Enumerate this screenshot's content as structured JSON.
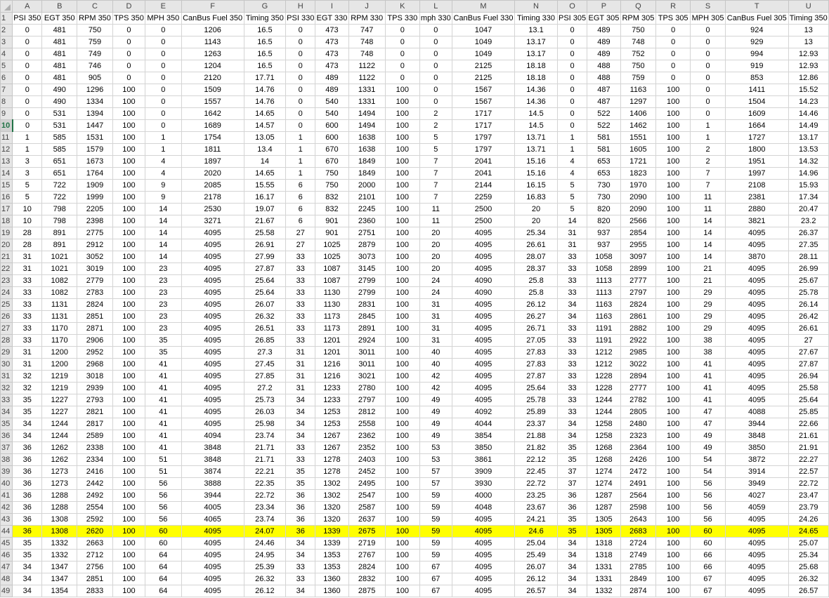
{
  "columns": [
    "A",
    "B",
    "C",
    "D",
    "E",
    "F",
    "G",
    "H",
    "I",
    "J",
    "K",
    "L",
    "M",
    "N",
    "O",
    "P",
    "Q",
    "R",
    "S",
    "T",
    "U"
  ],
  "highlight_color": "#ffff00",
  "selected_row": 10,
  "highlighted_row": 44,
  "rows": [
    {
      "num": 1,
      "cells": [
        "PSI 350",
        "EGT 350",
        "RPM 350",
        "TPS 350",
        "MPH 350",
        "CanBus Fuel 350",
        "Timing 350",
        "PSI 330",
        "EGT 330",
        "RPM 330",
        "TPS 330",
        "mph 330",
        "CanBus Fuel 330",
        "Timing 330",
        "PSI 305",
        "EGT 305",
        "RPM 305",
        "TPS 305",
        "MPH 305",
        "CanBus Fuel 305",
        "Timing 350"
      ]
    },
    {
      "num": 2,
      "cells": [
        "0",
        "481",
        "750",
        "0",
        "0",
        "1206",
        "16.5",
        "0",
        "473",
        "747",
        "0",
        "0",
        "1047",
        "13.1",
        "0",
        "489",
        "750",
        "0",
        "0",
        "924",
        "13"
      ]
    },
    {
      "num": 3,
      "cells": [
        "0",
        "481",
        "759",
        "0",
        "0",
        "1143",
        "16.5",
        "0",
        "473",
        "748",
        "0",
        "0",
        "1049",
        "13.17",
        "0",
        "489",
        "748",
        "0",
        "0",
        "929",
        "13"
      ]
    },
    {
      "num": 4,
      "cells": [
        "0",
        "481",
        "749",
        "0",
        "0",
        "1263",
        "16.5",
        "0",
        "473",
        "748",
        "0",
        "0",
        "1049",
        "13.17",
        "0",
        "489",
        "752",
        "0",
        "0",
        "994",
        "12.93"
      ]
    },
    {
      "num": 5,
      "cells": [
        "0",
        "481",
        "746",
        "0",
        "0",
        "1204",
        "16.5",
        "0",
        "473",
        "1122",
        "0",
        "0",
        "2125",
        "18.18",
        "0",
        "488",
        "750",
        "0",
        "0",
        "919",
        "12.93"
      ]
    },
    {
      "num": 6,
      "cells": [
        "0",
        "481",
        "905",
        "0",
        "0",
        "2120",
        "17.71",
        "0",
        "489",
        "1122",
        "0",
        "0",
        "2125",
        "18.18",
        "0",
        "488",
        "759",
        "0",
        "0",
        "853",
        "12.86"
      ]
    },
    {
      "num": 7,
      "cells": [
        "0",
        "490",
        "1296",
        "100",
        "0",
        "1509",
        "14.76",
        "0",
        "489",
        "1331",
        "100",
        "0",
        "1567",
        "14.36",
        "0",
        "487",
        "1163",
        "100",
        "0",
        "1411",
        "15.52"
      ]
    },
    {
      "num": 8,
      "cells": [
        "0",
        "490",
        "1334",
        "100",
        "0",
        "1557",
        "14.76",
        "0",
        "540",
        "1331",
        "100",
        "0",
        "1567",
        "14.36",
        "0",
        "487",
        "1297",
        "100",
        "0",
        "1504",
        "14.23"
      ]
    },
    {
      "num": 9,
      "cells": [
        "0",
        "531",
        "1394",
        "100",
        "0",
        "1642",
        "14.65",
        "0",
        "540",
        "1494",
        "100",
        "2",
        "1717",
        "14.5",
        "0",
        "522",
        "1406",
        "100",
        "0",
        "1609",
        "14.46"
      ]
    },
    {
      "num": 10,
      "cells": [
        "0",
        "531",
        "1447",
        "100",
        "0",
        "1689",
        "14.57",
        "0",
        "600",
        "1494",
        "100",
        "2",
        "1717",
        "14.5",
        "0",
        "522",
        "1462",
        "100",
        "1",
        "1664",
        "14.49"
      ]
    },
    {
      "num": 11,
      "cells": [
        "1",
        "585",
        "1531",
        "100",
        "1",
        "1754",
        "13.05",
        "1",
        "600",
        "1638",
        "100",
        "5",
        "1797",
        "13.71",
        "1",
        "581",
        "1551",
        "100",
        "1",
        "1727",
        "13.17"
      ]
    },
    {
      "num": 12,
      "cells": [
        "1",
        "585",
        "1579",
        "100",
        "1",
        "1811",
        "13.4",
        "1",
        "670",
        "1638",
        "100",
        "5",
        "1797",
        "13.71",
        "1",
        "581",
        "1605",
        "100",
        "2",
        "1800",
        "13.53"
      ]
    },
    {
      "num": 13,
      "cells": [
        "3",
        "651",
        "1673",
        "100",
        "4",
        "1897",
        "14",
        "1",
        "670",
        "1849",
        "100",
        "7",
        "2041",
        "15.16",
        "4",
        "653",
        "1721",
        "100",
        "2",
        "1951",
        "14.32"
      ]
    },
    {
      "num": 14,
      "cells": [
        "3",
        "651",
        "1764",
        "100",
        "4",
        "2020",
        "14.65",
        "1",
        "750",
        "1849",
        "100",
        "7",
        "2041",
        "15.16",
        "4",
        "653",
        "1823",
        "100",
        "7",
        "1997",
        "14.96"
      ]
    },
    {
      "num": 15,
      "cells": [
        "5",
        "722",
        "1909",
        "100",
        "9",
        "2085",
        "15.55",
        "6",
        "750",
        "2000",
        "100",
        "7",
        "2144",
        "16.15",
        "5",
        "730",
        "1970",
        "100",
        "7",
        "2108",
        "15.93"
      ]
    },
    {
      "num": 16,
      "cells": [
        "5",
        "722",
        "1999",
        "100",
        "9",
        "2178",
        "16.17",
        "6",
        "832",
        "2101",
        "100",
        "7",
        "2259",
        "16.83",
        "5",
        "730",
        "2090",
        "100",
        "11",
        "2381",
        "17.34"
      ]
    },
    {
      "num": 17,
      "cells": [
        "10",
        "798",
        "2205",
        "100",
        "14",
        "2530",
        "19.07",
        "6",
        "832",
        "2245",
        "100",
        "11",
        "2500",
        "20",
        "5",
        "820",
        "2090",
        "100",
        "11",
        "2880",
        "20.47"
      ]
    },
    {
      "num": 18,
      "cells": [
        "10",
        "798",
        "2398",
        "100",
        "14",
        "3271",
        "21.67",
        "6",
        "901",
        "2360",
        "100",
        "11",
        "2500",
        "20",
        "14",
        "820",
        "2566",
        "100",
        "14",
        "3821",
        "23.2"
      ]
    },
    {
      "num": 19,
      "cells": [
        "28",
        "891",
        "2775",
        "100",
        "14",
        "4095",
        "25.58",
        "27",
        "901",
        "2751",
        "100",
        "20",
        "4095",
        "25.34",
        "31",
        "937",
        "2854",
        "100",
        "14",
        "4095",
        "26.37"
      ]
    },
    {
      "num": 20,
      "cells": [
        "28",
        "891",
        "2912",
        "100",
        "14",
        "4095",
        "26.91",
        "27",
        "1025",
        "2879",
        "100",
        "20",
        "4095",
        "26.61",
        "31",
        "937",
        "2955",
        "100",
        "14",
        "4095",
        "27.35"
      ]
    },
    {
      "num": 21,
      "cells": [
        "31",
        "1021",
        "3052",
        "100",
        "14",
        "4095",
        "27.99",
        "33",
        "1025",
        "3073",
        "100",
        "20",
        "4095",
        "28.07",
        "33",
        "1058",
        "3097",
        "100",
        "14",
        "3870",
        "28.11"
      ]
    },
    {
      "num": 22,
      "cells": [
        "31",
        "1021",
        "3019",
        "100",
        "23",
        "4095",
        "27.87",
        "33",
        "1087",
        "3145",
        "100",
        "20",
        "4095",
        "28.37",
        "33",
        "1058",
        "2899",
        "100",
        "21",
        "4095",
        "26.99"
      ]
    },
    {
      "num": 23,
      "cells": [
        "33",
        "1082",
        "2779",
        "100",
        "23",
        "4095",
        "25.64",
        "33",
        "1087",
        "2799",
        "100",
        "24",
        "4090",
        "25.8",
        "33",
        "1113",
        "2777",
        "100",
        "21",
        "4095",
        "25.67"
      ]
    },
    {
      "num": 24,
      "cells": [
        "33",
        "1082",
        "2783",
        "100",
        "23",
        "4095",
        "25.64",
        "33",
        "1130",
        "2799",
        "100",
        "24",
        "4090",
        "25.8",
        "33",
        "1113",
        "2797",
        "100",
        "29",
        "4095",
        "25.78"
      ]
    },
    {
      "num": 25,
      "cells": [
        "33",
        "1131",
        "2824",
        "100",
        "23",
        "4095",
        "26.07",
        "33",
        "1130",
        "2831",
        "100",
        "31",
        "4095",
        "26.12",
        "34",
        "1163",
        "2824",
        "100",
        "29",
        "4095",
        "26.14"
      ]
    },
    {
      "num": 26,
      "cells": [
        "33",
        "1131",
        "2851",
        "100",
        "23",
        "4095",
        "26.32",
        "33",
        "1173",
        "2845",
        "100",
        "31",
        "4095",
        "26.27",
        "34",
        "1163",
        "2861",
        "100",
        "29",
        "4095",
        "26.42"
      ]
    },
    {
      "num": 27,
      "cells": [
        "33",
        "1170",
        "2871",
        "100",
        "23",
        "4095",
        "26.51",
        "33",
        "1173",
        "2891",
        "100",
        "31",
        "4095",
        "26.71",
        "33",
        "1191",
        "2882",
        "100",
        "29",
        "4095",
        "26.61"
      ]
    },
    {
      "num": 28,
      "cells": [
        "33",
        "1170",
        "2906",
        "100",
        "35",
        "4095",
        "26.85",
        "33",
        "1201",
        "2924",
        "100",
        "31",
        "4095",
        "27.05",
        "33",
        "1191",
        "2922",
        "100",
        "38",
        "4095",
        "27"
      ]
    },
    {
      "num": 29,
      "cells": [
        "31",
        "1200",
        "2952",
        "100",
        "35",
        "4095",
        "27.3",
        "31",
        "1201",
        "3011",
        "100",
        "40",
        "4095",
        "27.83",
        "33",
        "1212",
        "2985",
        "100",
        "38",
        "4095",
        "27.67"
      ]
    },
    {
      "num": 30,
      "cells": [
        "31",
        "1200",
        "2968",
        "100",
        "41",
        "4095",
        "27.45",
        "31",
        "1216",
        "3011",
        "100",
        "40",
        "4095",
        "27.83",
        "33",
        "1212",
        "3022",
        "100",
        "41",
        "4095",
        "27.87"
      ]
    },
    {
      "num": 31,
      "cells": [
        "32",
        "1219",
        "3018",
        "100",
        "41",
        "4095",
        "27.85",
        "31",
        "1216",
        "3021",
        "100",
        "42",
        "4095",
        "27.87",
        "33",
        "1228",
        "2894",
        "100",
        "41",
        "4095",
        "26.94"
      ]
    },
    {
      "num": 32,
      "cells": [
        "32",
        "1219",
        "2939",
        "100",
        "41",
        "4095",
        "27.2",
        "31",
        "1233",
        "2780",
        "100",
        "42",
        "4095",
        "25.64",
        "33",
        "1228",
        "2777",
        "100",
        "41",
        "4095",
        "25.58"
      ]
    },
    {
      "num": 33,
      "cells": [
        "35",
        "1227",
        "2793",
        "100",
        "41",
        "4095",
        "25.73",
        "34",
        "1233",
        "2797",
        "100",
        "49",
        "4095",
        "25.78",
        "33",
        "1244",
        "2782",
        "100",
        "41",
        "4095",
        "25.64"
      ]
    },
    {
      "num": 34,
      "cells": [
        "35",
        "1227",
        "2821",
        "100",
        "41",
        "4095",
        "26.03",
        "34",
        "1253",
        "2812",
        "100",
        "49",
        "4092",
        "25.89",
        "33",
        "1244",
        "2805",
        "100",
        "47",
        "4088",
        "25.85"
      ]
    },
    {
      "num": 35,
      "cells": [
        "34",
        "1244",
        "2817",
        "100",
        "41",
        "4095",
        "25.98",
        "34",
        "1253",
        "2558",
        "100",
        "49",
        "4044",
        "23.37",
        "34",
        "1258",
        "2480",
        "100",
        "47",
        "3944",
        "22.66"
      ]
    },
    {
      "num": 36,
      "cells": [
        "34",
        "1244",
        "2589",
        "100",
        "41",
        "4094",
        "23.74",
        "34",
        "1267",
        "2362",
        "100",
        "49",
        "3854",
        "21.88",
        "34",
        "1258",
        "2323",
        "100",
        "49",
        "3848",
        "21.61"
      ]
    },
    {
      "num": 37,
      "cells": [
        "36",
        "1262",
        "2338",
        "100",
        "41",
        "3848",
        "21.71",
        "33",
        "1267",
        "2352",
        "100",
        "53",
        "3850",
        "21.82",
        "35",
        "1268",
        "2364",
        "100",
        "49",
        "3850",
        "21.91"
      ]
    },
    {
      "num": 38,
      "cells": [
        "36",
        "1262",
        "2334",
        "100",
        "51",
        "3848",
        "21.71",
        "33",
        "1278",
        "2403",
        "100",
        "53",
        "3861",
        "22.12",
        "35",
        "1268",
        "2426",
        "100",
        "54",
        "3872",
        "22.27"
      ]
    },
    {
      "num": 39,
      "cells": [
        "36",
        "1273",
        "2416",
        "100",
        "51",
        "3874",
        "22.21",
        "35",
        "1278",
        "2452",
        "100",
        "57",
        "3909",
        "22.45",
        "37",
        "1274",
        "2472",
        "100",
        "54",
        "3914",
        "22.57"
      ]
    },
    {
      "num": 40,
      "cells": [
        "36",
        "1273",
        "2442",
        "100",
        "56",
        "3888",
        "22.35",
        "35",
        "1302",
        "2495",
        "100",
        "57",
        "3930",
        "22.72",
        "37",
        "1274",
        "2491",
        "100",
        "56",
        "3949",
        "22.72"
      ]
    },
    {
      "num": 41,
      "cells": [
        "36",
        "1288",
        "2492",
        "100",
        "56",
        "3944",
        "22.72",
        "36",
        "1302",
        "2547",
        "100",
        "59",
        "4000",
        "23.25",
        "36",
        "1287",
        "2564",
        "100",
        "56",
        "4027",
        "23.47"
      ]
    },
    {
      "num": 42,
      "cells": [
        "36",
        "1288",
        "2554",
        "100",
        "56",
        "4005",
        "23.34",
        "36",
        "1320",
        "2587",
        "100",
        "59",
        "4048",
        "23.67",
        "36",
        "1287",
        "2598",
        "100",
        "56",
        "4059",
        "23.79"
      ]
    },
    {
      "num": 43,
      "cells": [
        "36",
        "1308",
        "2592",
        "100",
        "56",
        "4065",
        "23.74",
        "36",
        "1320",
        "2637",
        "100",
        "59",
        "4095",
        "24.21",
        "35",
        "1305",
        "2643",
        "100",
        "56",
        "4095",
        "24.26"
      ]
    },
    {
      "num": 44,
      "cells": [
        "36",
        "1308",
        "2620",
        "100",
        "60",
        "4095",
        "24.07",
        "36",
        "1339",
        "2675",
        "100",
        "59",
        "4095",
        "24.6",
        "35",
        "1305",
        "2683",
        "100",
        "60",
        "4095",
        "24.65"
      ]
    },
    {
      "num": 45,
      "cells": [
        "35",
        "1332",
        "2663",
        "100",
        "60",
        "4095",
        "24.46",
        "34",
        "1339",
        "2719",
        "100",
        "59",
        "4095",
        "25.04",
        "34",
        "1318",
        "2724",
        "100",
        "60",
        "4095",
        "25.07"
      ]
    },
    {
      "num": 46,
      "cells": [
        "35",
        "1332",
        "2712",
        "100",
        "64",
        "4095",
        "24.95",
        "34",
        "1353",
        "2767",
        "100",
        "59",
        "4095",
        "25.49",
        "34",
        "1318",
        "2749",
        "100",
        "66",
        "4095",
        "25.34"
      ]
    },
    {
      "num": 47,
      "cells": [
        "34",
        "1347",
        "2756",
        "100",
        "64",
        "4095",
        "25.39",
        "33",
        "1353",
        "2824",
        "100",
        "67",
        "4095",
        "26.07",
        "34",
        "1331",
        "2785",
        "100",
        "66",
        "4095",
        "25.68"
      ]
    },
    {
      "num": 48,
      "cells": [
        "34",
        "1347",
        "2851",
        "100",
        "64",
        "4095",
        "26.32",
        "33",
        "1360",
        "2832",
        "100",
        "67",
        "4095",
        "26.12",
        "34",
        "1331",
        "2849",
        "100",
        "67",
        "4095",
        "26.32"
      ]
    },
    {
      "num": 49,
      "cells": [
        "34",
        "1354",
        "2833",
        "100",
        "64",
        "4095",
        "26.12",
        "34",
        "1360",
        "2875",
        "100",
        "67",
        "4095",
        "26.57",
        "34",
        "1332",
        "2874",
        "100",
        "67",
        "4095",
        "26.57"
      ]
    }
  ]
}
